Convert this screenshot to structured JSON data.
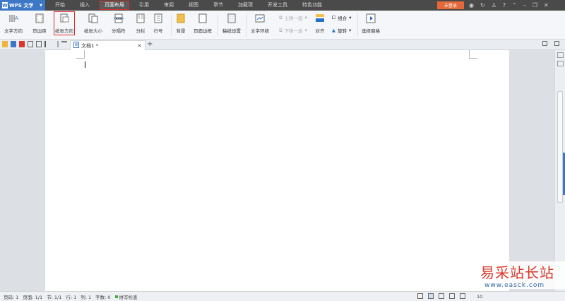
{
  "app": {
    "name": "WPS 文字",
    "logo_letter": "W"
  },
  "menu": [
    {
      "label": "开始"
    },
    {
      "label": "插入"
    },
    {
      "label": "页面布局",
      "active": true
    },
    {
      "label": "引用"
    },
    {
      "label": "审阅"
    },
    {
      "label": "视图"
    },
    {
      "label": "章节"
    },
    {
      "label": "加载项"
    },
    {
      "label": "开发工具"
    },
    {
      "label": "特色功能"
    }
  ],
  "login_label": "未登录",
  "window_controls": {
    "question": "?"
  },
  "ribbon": {
    "text_direction": "文字方向",
    "margins": "页边距",
    "orientation": "纸张方向",
    "paper_size": "纸张大小",
    "separator": "分隔符",
    "columns": "分栏",
    "line_number": "行号",
    "background": "背景",
    "page_border": "页面边框",
    "draft_paper": "稿纸设置",
    "text_wrap": "文字环绕",
    "bring_forward": "上移一层",
    "send_backward": "下移一层",
    "align": "对齐",
    "group": "组合",
    "rotate": "旋转",
    "selection_pane": "选择窗格"
  },
  "tab": {
    "doc_name": "文档1 *",
    "close": "×",
    "new": "+"
  },
  "status": {
    "page_no": "页码: 1",
    "pages": "页面: 1/1",
    "section": "节: 1/1",
    "row": "行: 1",
    "col": "列: 1",
    "word_count": "字数: 0",
    "spell_check": "拼写检查",
    "zoom": "10"
  },
  "watermark": {
    "cn": "易采站长站",
    "url": "www.easck.com"
  },
  "colors": {
    "accent": "#3d78c7",
    "highlight": "#d9302a",
    "login": "#e4683a"
  }
}
